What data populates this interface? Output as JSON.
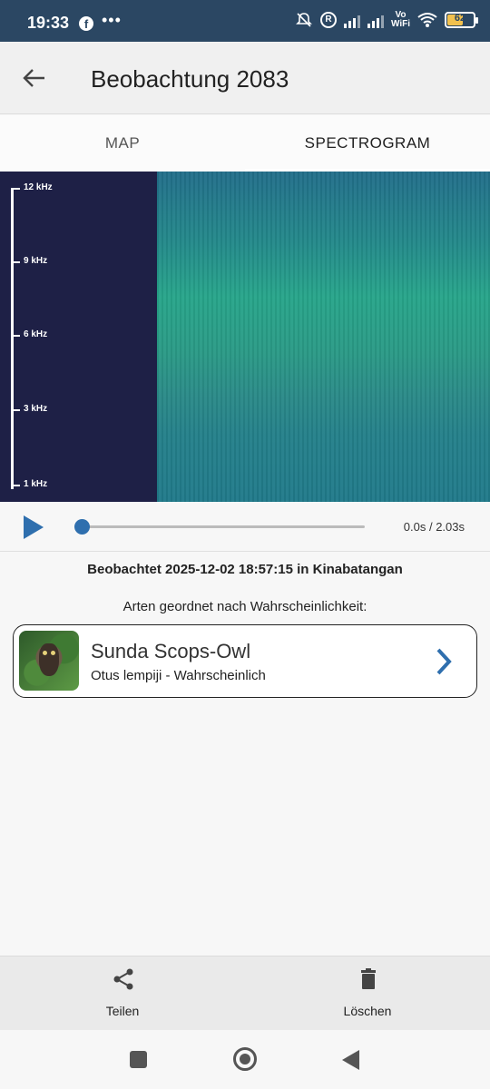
{
  "status_bar": {
    "time": "19:33",
    "fb": "f",
    "dots": "•••",
    "vowifi": "Vo\nWiFi",
    "r_badge": "R",
    "battery": "62"
  },
  "app_bar": {
    "title": "Beobachtung 2083"
  },
  "tabs": [
    {
      "label": "MAP"
    },
    {
      "label": "SPECTROGRAM"
    }
  ],
  "spectrogram": {
    "freq_labels": [
      "12 kHz",
      "9 kHz",
      "6 kHz",
      "3 kHz",
      "1 kHz"
    ]
  },
  "player": {
    "time": "0.0s / 2.03s",
    "progress": 0
  },
  "observation": {
    "observed": "Beobachtet 2025-12-02 18:57:15 in Kinabatangan",
    "species_header": "Arten geordnet nach Wahrscheinlichkeit:"
  },
  "species": [
    {
      "common_name": "Sunda Scops-Owl",
      "detail": "Otus lempiji - Wahrscheinlich"
    }
  ],
  "actions": {
    "share_label": "Teilen",
    "delete_label": "Löschen"
  },
  "colors": {
    "status_bar": "#2b4763",
    "accent": "#2f6fae",
    "spectro_bg": "#1e2046"
  }
}
